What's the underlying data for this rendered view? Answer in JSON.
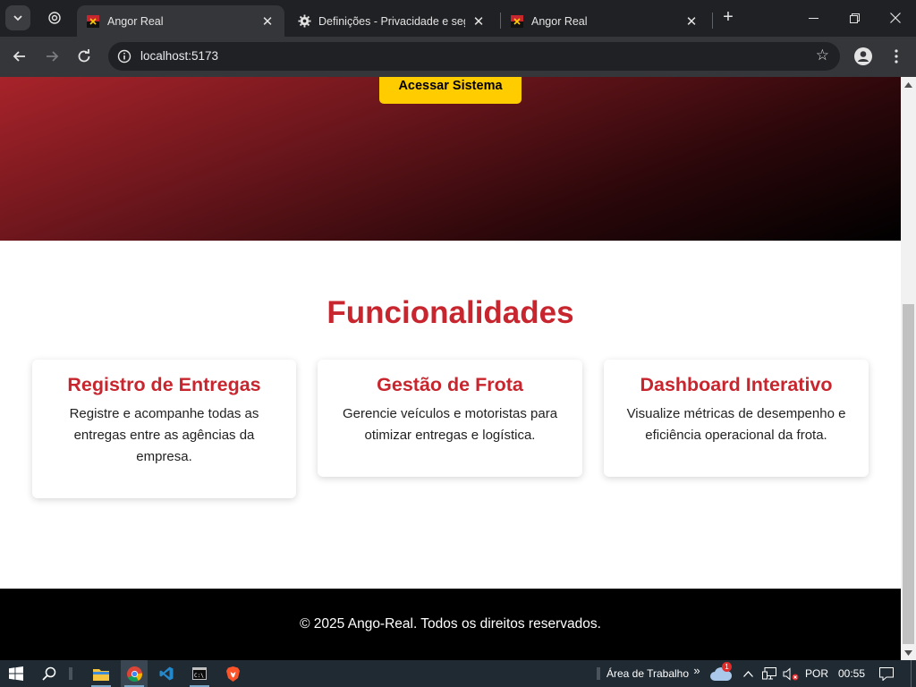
{
  "browser": {
    "tabs": [
      {
        "title": "Angor Real",
        "active": true
      },
      {
        "title": "Definições - Privacidade e segurança",
        "active": false
      },
      {
        "title": "Angor Real",
        "active": false
      }
    ],
    "url": "localhost:5173",
    "new_tab_symbol": "+"
  },
  "page": {
    "cta_label": "Acessar Sistema",
    "features_title": "Funcionalidades",
    "features": [
      {
        "title": "Registro de Entregas",
        "description": "Registre e acompanhe todas as entregas entre as agências da empresa."
      },
      {
        "title": "Gestão de Frota",
        "description": "Gerencie veículos e motoristas para otimizar entregas e logística."
      },
      {
        "title": "Dashboard Interativo",
        "description": "Visualize métricas de desempenho e eficiência operacional da frota."
      }
    ],
    "footer_text": "© 2025 Ango-Real. Todos os direitos reservados."
  },
  "colors": {
    "accent_red": "#c8262e",
    "cta_yellow": "#ffcc00",
    "footer_bg": "#000000"
  },
  "taskbar": {
    "desktop_label": "Área de Trabalho",
    "chevron": "»",
    "weather_badge": "1",
    "language": "POR",
    "time": "00:55",
    "apps": [
      "start-icon",
      "search-icon",
      "file-explorer-icon",
      "chrome-icon",
      "vscode-icon",
      "terminal-icon",
      "brave-icon"
    ]
  }
}
